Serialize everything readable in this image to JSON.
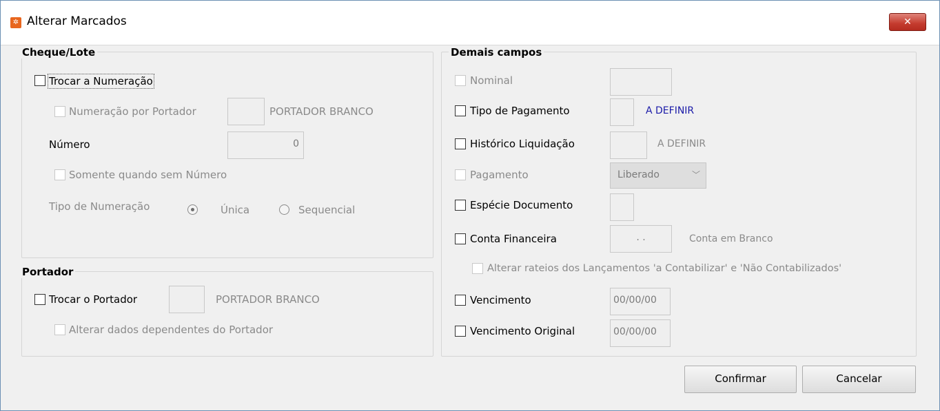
{
  "window": {
    "title": "Alterar Marcados",
    "close_label": "✕"
  },
  "cheque_lote": {
    "title": "Cheque/Lote",
    "trocar_numeracao": "Trocar a Numeração",
    "numeracao_portador": "Numeração por Portador",
    "portador_value": "",
    "portador_label": "PORTADOR BRANCO",
    "numero_label": "Número",
    "numero_value": "0",
    "somente_sem_numero": "Somente quando sem Número",
    "tipo_numeracao_label": "Tipo de Numeração",
    "radio_unica": "Única",
    "radio_sequencial": "Sequencial",
    "selected": "Única"
  },
  "portador": {
    "title": "Portador",
    "trocar_portador": "Trocar o Portador",
    "portador_value": "",
    "portador_label": "PORTADOR BRANCO",
    "alterar_dependentes": "Alterar dados dependentes do Portador"
  },
  "demais": {
    "title": "Demais campos",
    "nominal": "Nominal",
    "tipo_pagamento": "Tipo de Pagamento",
    "tipo_pagamento_value": "A DEFINIR",
    "historico": "Histórico Liquidação",
    "historico_value": "A DEFINIR",
    "pagamento": "Pagamento",
    "pagamento_select": "Liberado",
    "especie": "Espécie Documento",
    "conta": "Conta Financeira",
    "conta_field": ". .",
    "conta_value": "Conta em Branco",
    "alterar_rateios": "Alterar rateios dos Lançamentos 'a Contabilizar' e 'Não Contabilizados'",
    "vencimento": "Vencimento",
    "vencimento_value": "00/00/00",
    "vencimento_original": "Vencimento Original",
    "vencimento_original_value": "00/00/00"
  },
  "buttons": {
    "confirmar": "Confirmar",
    "cancelar": "Cancelar"
  },
  "colors": {
    "accent_blue": "#1a1aa8",
    "close_red": "#c43b2e"
  }
}
